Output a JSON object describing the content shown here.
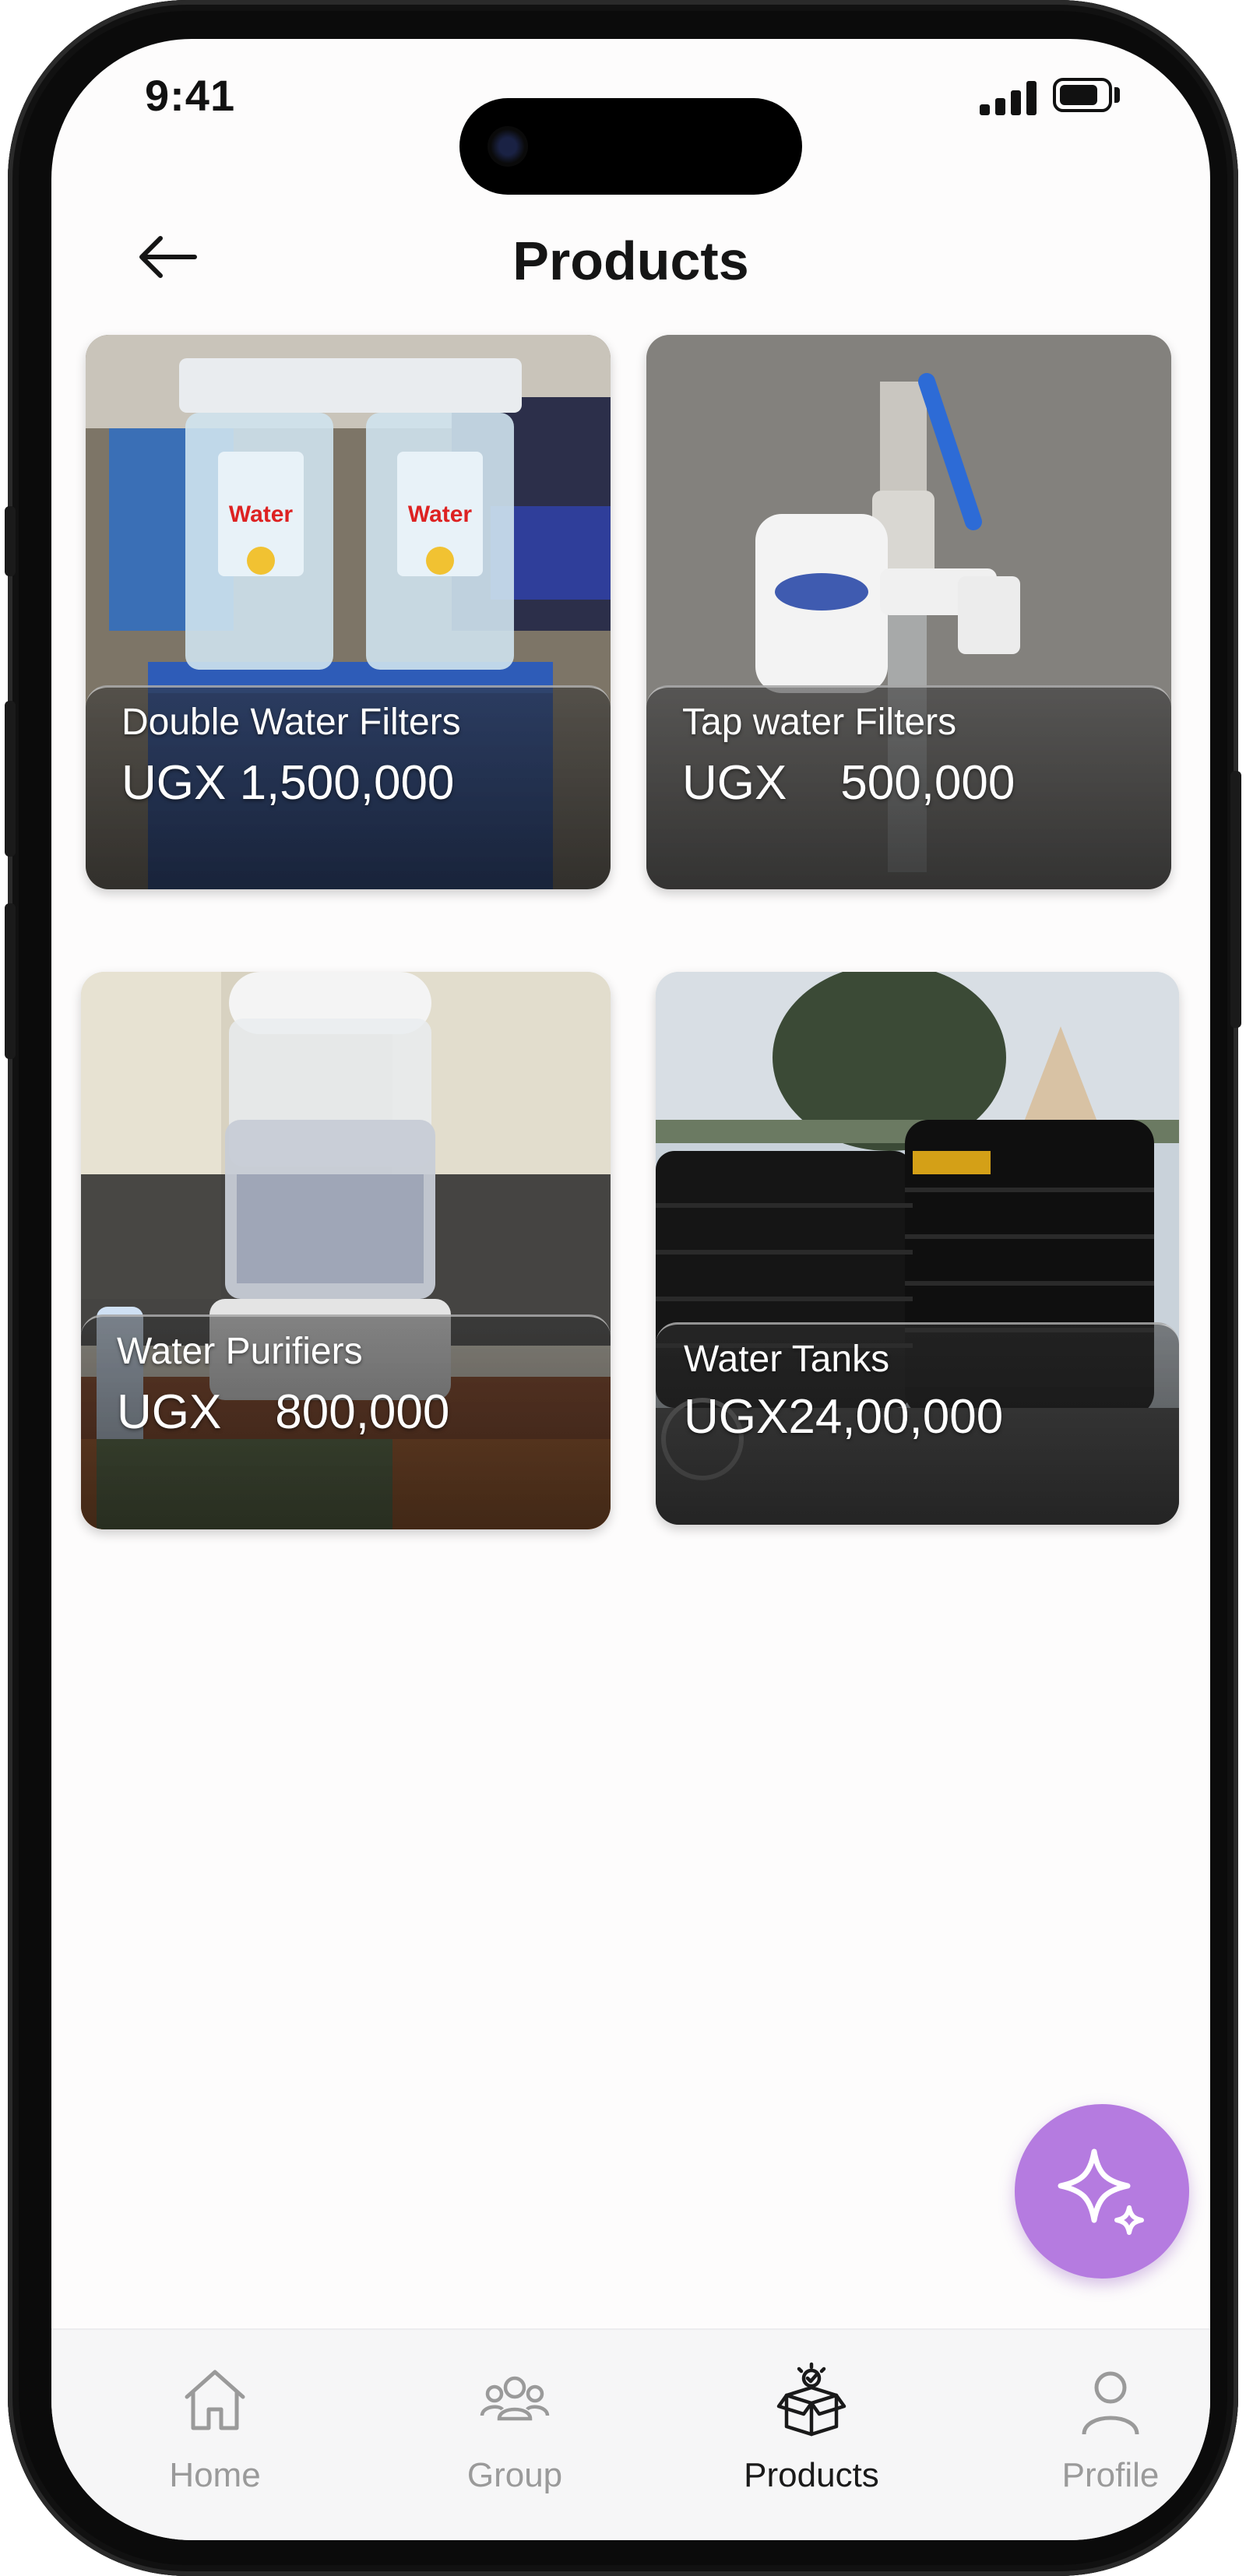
{
  "status_bar": {
    "time": "9:41"
  },
  "header": {
    "title": "Products"
  },
  "products": [
    {
      "name": "Double Water Filters",
      "price": "UGX 1,500,000"
    },
    {
      "name": "Tap water Filters",
      "price": "UGX    500,000"
    },
    {
      "name": "Water Purifiers",
      "price": "UGX    800,000"
    },
    {
      "name": "Water Tanks",
      "price": "UGX24,00,000"
    }
  ],
  "fab": {
    "icon": "sparkle-icon",
    "color": "#b57be0"
  },
  "tabbar": {
    "items": [
      {
        "label": "Home",
        "icon": "home-icon"
      },
      {
        "label": "Group",
        "icon": "group-icon"
      },
      {
        "label": "Products",
        "icon": "products-box-icon",
        "active": true
      },
      {
        "label": "Profile",
        "icon": "profile-icon"
      }
    ]
  }
}
